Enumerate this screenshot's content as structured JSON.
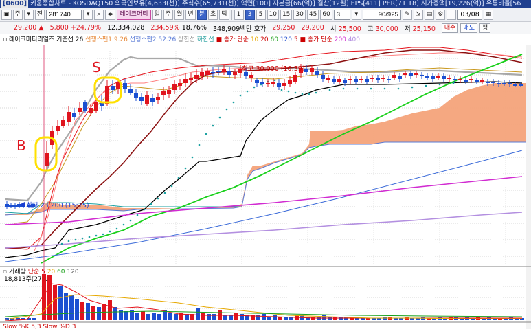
{
  "titlebar": {
    "panel_number": "[0600]",
    "text": "키움종합차트 - KOSDAQ150 외국인보유[4,633(천)] 주식수[65,731(천)] 액면[100] 자본금[66(억)] 결산[12월] EPS[411] PER[71.18] 시가총액[19,226(억)] 유통비율[56"
  },
  "toolbar": {
    "market_label": "주",
    "prev_label": "전",
    "stock_code": "281740",
    "stock_name": "레이크머티",
    "period_buttons": [
      "일",
      "주",
      "월",
      "년",
      "분",
      "초",
      "틱"
    ],
    "interval_buttons": [
      "1",
      "3",
      "5",
      "10",
      "15",
      "30",
      "45",
      "60"
    ],
    "selected_interval": "3",
    "interval_select": "3",
    "count_value": "90/925",
    "date_label": "03/08"
  },
  "pricebar": {
    "price": "29,200",
    "change": "5,800",
    "change_pct": "+24.79%",
    "volume": "12,334,028",
    "volume_ratio": "234.59%",
    "turnover": "18.76%",
    "amount": "348,909백만",
    "quote_label": "호가",
    "ask_price": "29,250",
    "bid_price": "29,200",
    "open_label": "시",
    "open": "25,500",
    "high_label": "고",
    "high": "30,000",
    "low_label": "저",
    "low": "25,150",
    "buy_button": "매수",
    "sell_button": "매도",
    "eval_button": "평"
  },
  "legend": {
    "name": "레이크머티리얼즈",
    "baseline": "기준선 26",
    "span1": "선행스팬1 9.26",
    "span2": "선행스팬2 52.26",
    "upper": "상한선",
    "lower": "하한선",
    "ma_title": "종가 단순",
    "ma_10": "10",
    "ma_20": "20",
    "ma_60": "60",
    "ma_120": "120",
    "ma_5": "5",
    "ma2_title": "종가 단순",
    "ma2_200": "200",
    "ma2_400": "400"
  },
  "chart": {
    "annotation_high": "최고 30,000 (10:39)",
    "annotation_low": "최저 23,200 (15:15)",
    "marker_b": "B",
    "marker_s": "S",
    "volume_legend_title": "거래량",
    "volume_legend_ma": "단순 5",
    "volume_legend_20": "20",
    "volume_legend_60": "60",
    "volume_legend_120": "120",
    "volume_max_label": "18,813주(27,1",
    "stoch_label": "Slow %K 5,3  Slow %D 3"
  },
  "colors": {
    "up": "#e0141e",
    "down": "#1b4fd1",
    "cloud": "#f4a37a",
    "highlight": "#ffe800"
  }
}
